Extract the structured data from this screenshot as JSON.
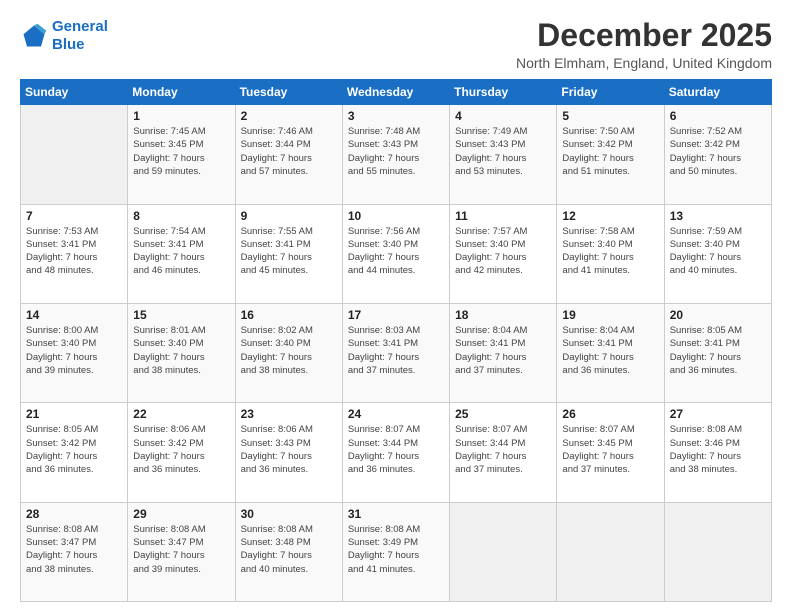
{
  "logo": {
    "line1": "General",
    "line2": "Blue"
  },
  "title": "December 2025",
  "location": "North Elmham, England, United Kingdom",
  "days_of_week": [
    "Sunday",
    "Monday",
    "Tuesday",
    "Wednesday",
    "Thursday",
    "Friday",
    "Saturday"
  ],
  "weeks": [
    [
      {
        "day": "",
        "info": ""
      },
      {
        "day": "1",
        "info": "Sunrise: 7:45 AM\nSunset: 3:45 PM\nDaylight: 7 hours\nand 59 minutes."
      },
      {
        "day": "2",
        "info": "Sunrise: 7:46 AM\nSunset: 3:44 PM\nDaylight: 7 hours\nand 57 minutes."
      },
      {
        "day": "3",
        "info": "Sunrise: 7:48 AM\nSunset: 3:43 PM\nDaylight: 7 hours\nand 55 minutes."
      },
      {
        "day": "4",
        "info": "Sunrise: 7:49 AM\nSunset: 3:43 PM\nDaylight: 7 hours\nand 53 minutes."
      },
      {
        "day": "5",
        "info": "Sunrise: 7:50 AM\nSunset: 3:42 PM\nDaylight: 7 hours\nand 51 minutes."
      },
      {
        "day": "6",
        "info": "Sunrise: 7:52 AM\nSunset: 3:42 PM\nDaylight: 7 hours\nand 50 minutes."
      }
    ],
    [
      {
        "day": "7",
        "info": "Sunrise: 7:53 AM\nSunset: 3:41 PM\nDaylight: 7 hours\nand 48 minutes."
      },
      {
        "day": "8",
        "info": "Sunrise: 7:54 AM\nSunset: 3:41 PM\nDaylight: 7 hours\nand 46 minutes."
      },
      {
        "day": "9",
        "info": "Sunrise: 7:55 AM\nSunset: 3:41 PM\nDaylight: 7 hours\nand 45 minutes."
      },
      {
        "day": "10",
        "info": "Sunrise: 7:56 AM\nSunset: 3:40 PM\nDaylight: 7 hours\nand 44 minutes."
      },
      {
        "day": "11",
        "info": "Sunrise: 7:57 AM\nSunset: 3:40 PM\nDaylight: 7 hours\nand 42 minutes."
      },
      {
        "day": "12",
        "info": "Sunrise: 7:58 AM\nSunset: 3:40 PM\nDaylight: 7 hours\nand 41 minutes."
      },
      {
        "day": "13",
        "info": "Sunrise: 7:59 AM\nSunset: 3:40 PM\nDaylight: 7 hours\nand 40 minutes."
      }
    ],
    [
      {
        "day": "14",
        "info": "Sunrise: 8:00 AM\nSunset: 3:40 PM\nDaylight: 7 hours\nand 39 minutes."
      },
      {
        "day": "15",
        "info": "Sunrise: 8:01 AM\nSunset: 3:40 PM\nDaylight: 7 hours\nand 38 minutes."
      },
      {
        "day": "16",
        "info": "Sunrise: 8:02 AM\nSunset: 3:40 PM\nDaylight: 7 hours\nand 38 minutes."
      },
      {
        "day": "17",
        "info": "Sunrise: 8:03 AM\nSunset: 3:41 PM\nDaylight: 7 hours\nand 37 minutes."
      },
      {
        "day": "18",
        "info": "Sunrise: 8:04 AM\nSunset: 3:41 PM\nDaylight: 7 hours\nand 37 minutes."
      },
      {
        "day": "19",
        "info": "Sunrise: 8:04 AM\nSunset: 3:41 PM\nDaylight: 7 hours\nand 36 minutes."
      },
      {
        "day": "20",
        "info": "Sunrise: 8:05 AM\nSunset: 3:41 PM\nDaylight: 7 hours\nand 36 minutes."
      }
    ],
    [
      {
        "day": "21",
        "info": "Sunrise: 8:05 AM\nSunset: 3:42 PM\nDaylight: 7 hours\nand 36 minutes."
      },
      {
        "day": "22",
        "info": "Sunrise: 8:06 AM\nSunset: 3:42 PM\nDaylight: 7 hours\nand 36 minutes."
      },
      {
        "day": "23",
        "info": "Sunrise: 8:06 AM\nSunset: 3:43 PM\nDaylight: 7 hours\nand 36 minutes."
      },
      {
        "day": "24",
        "info": "Sunrise: 8:07 AM\nSunset: 3:44 PM\nDaylight: 7 hours\nand 36 minutes."
      },
      {
        "day": "25",
        "info": "Sunrise: 8:07 AM\nSunset: 3:44 PM\nDaylight: 7 hours\nand 37 minutes."
      },
      {
        "day": "26",
        "info": "Sunrise: 8:07 AM\nSunset: 3:45 PM\nDaylight: 7 hours\nand 37 minutes."
      },
      {
        "day": "27",
        "info": "Sunrise: 8:08 AM\nSunset: 3:46 PM\nDaylight: 7 hours\nand 38 minutes."
      }
    ],
    [
      {
        "day": "28",
        "info": "Sunrise: 8:08 AM\nSunset: 3:47 PM\nDaylight: 7 hours\nand 38 minutes."
      },
      {
        "day": "29",
        "info": "Sunrise: 8:08 AM\nSunset: 3:47 PM\nDaylight: 7 hours\nand 39 minutes."
      },
      {
        "day": "30",
        "info": "Sunrise: 8:08 AM\nSunset: 3:48 PM\nDaylight: 7 hours\nand 40 minutes."
      },
      {
        "day": "31",
        "info": "Sunrise: 8:08 AM\nSunset: 3:49 PM\nDaylight: 7 hours\nand 41 minutes."
      },
      {
        "day": "",
        "info": ""
      },
      {
        "day": "",
        "info": ""
      },
      {
        "day": "",
        "info": ""
      }
    ]
  ]
}
